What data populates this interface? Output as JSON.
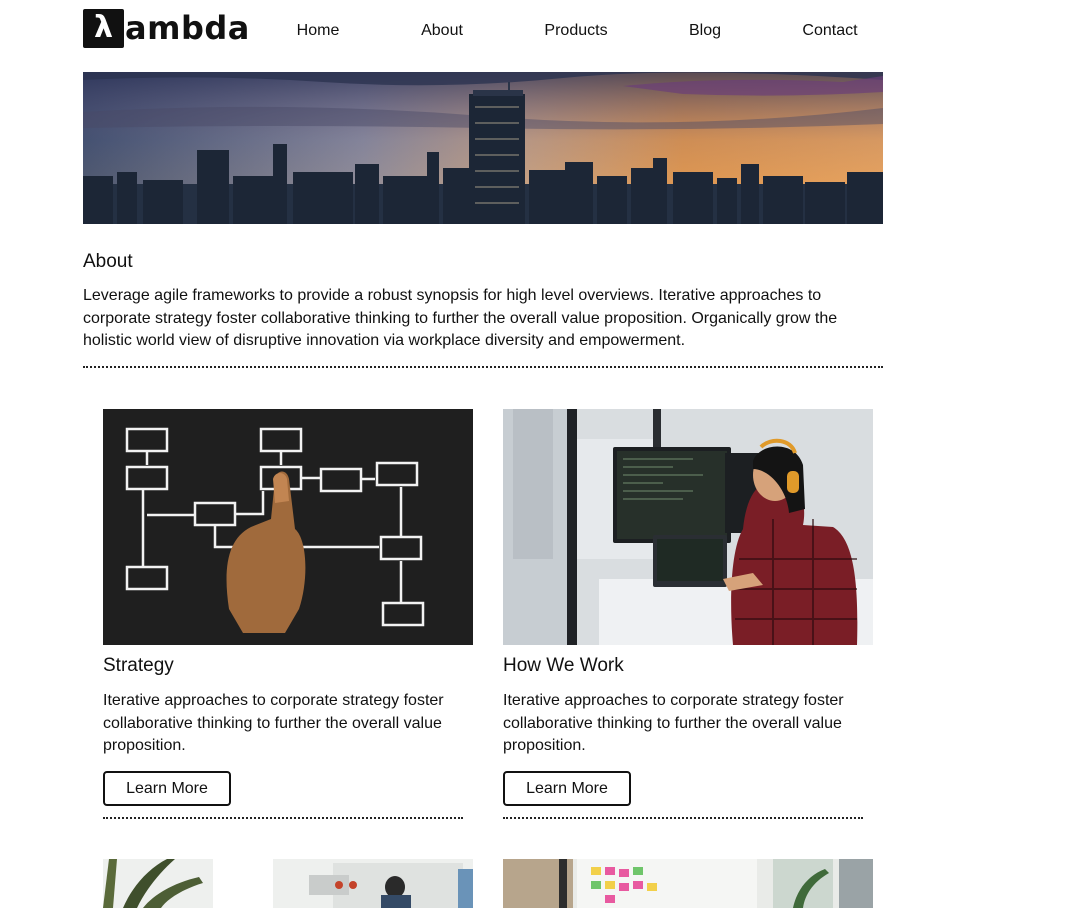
{
  "logo": {
    "mark": "λ",
    "text": "ambda"
  },
  "nav": {
    "items": [
      {
        "label": "Home"
      },
      {
        "label": "About"
      },
      {
        "label": "Products"
      },
      {
        "label": "Blog"
      },
      {
        "label": "Contact"
      }
    ]
  },
  "about": {
    "title": "About",
    "text": "Leverage agile frameworks to provide a robust synopsis for high level overviews. Iterative approaches to corporate strategy foster collaborative thinking to further the overall value proposition. Organically grow the holistic world view of disruptive innovation via workplace diversity and empowerment."
  },
  "cards": [
    {
      "title": "Strategy",
      "text": "Iterative approaches to corporate strategy foster collaborative thinking to further the overall value proposition.",
      "button": "Learn More"
    },
    {
      "title": "How We Work",
      "text": "Iterative approaches to corporate strategy foster collaborative thinking to further the overall value proposition.",
      "button": "Learn More"
    }
  ],
  "icons": [
    "lambda-logo-icon"
  ],
  "colors": {
    "text": "#111111",
    "background": "#ffffff",
    "button_border": "#111111"
  }
}
